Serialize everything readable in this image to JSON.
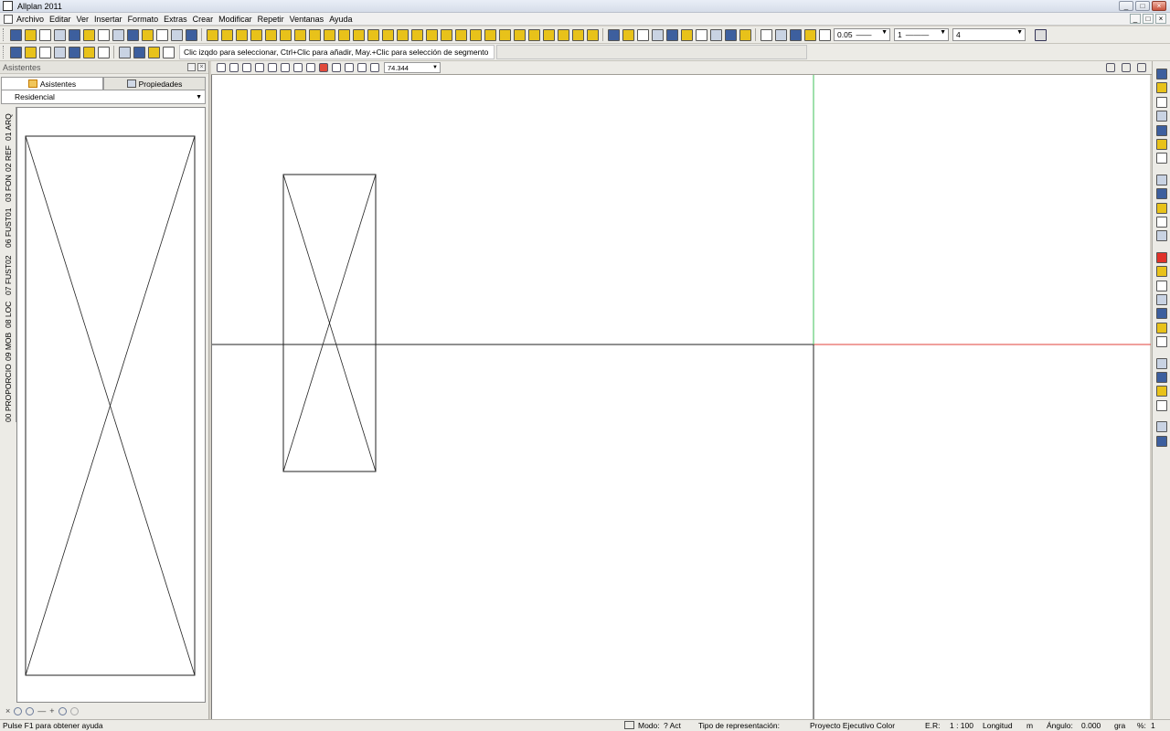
{
  "window": {
    "title": "Allplan 2011",
    "minimize": "_",
    "maximize": "□",
    "close": "×"
  },
  "menu": {
    "items": [
      "Archivo",
      "Editar",
      "Ver",
      "Insertar",
      "Formato",
      "Extras",
      "Crear",
      "Modificar",
      "Repetir",
      "Ventanas",
      "Ayuda"
    ]
  },
  "toolbar": {
    "pen_thickness": "0.05",
    "line_type": "1",
    "line_color": "4",
    "hint": "Clic izqdo para seleccionar, Ctrl+Clic para añadir, May.+Clic para selección de segmento"
  },
  "panel": {
    "title": "Asistentes",
    "tabs": [
      {
        "label": "Asistentes"
      },
      {
        "label": "Propiedades"
      }
    ],
    "selected_assistant": "Residencial",
    "vertical_tabs": [
      "01 ARQ",
      "02 REF",
      "03 FON",
      "06 FUST01",
      "07 FUST02",
      "08 LOC",
      "09 MOB",
      "00 PROPORCIO"
    ],
    "close_label": "×"
  },
  "view": {
    "zoom": "74.344"
  },
  "status": {
    "help": "Pulse F1 para obtener ayuda",
    "mode_label": "Modo:",
    "mode_value": "? Act",
    "repr_label": "Tipo de representación:",
    "repr_value": "Proyecto Ejecutivo Color",
    "scale_label": "E.R:",
    "scale_value": "1 : 100",
    "length_label": "Longitud",
    "length_unit": "m",
    "angle_label": "Ángulo:",
    "angle_value": "0.000",
    "angle_unit": "gra",
    "percent_label": "%:",
    "percent_value": "1"
  },
  "colors": {
    "axis_x": "#e0403a",
    "axis_y": "#3fc25a",
    "toolbar_icon_yellow": "#e8c21a",
    "toolbar_icon_blue": "#3d5f9e"
  },
  "icons": {
    "toolbar1": [
      "new-icon",
      "open-icon",
      "save-icon",
      "print-icon",
      "preview-icon",
      "layout-icon",
      "image-icon",
      "export-icon",
      "import-icon",
      "measure-icon",
      "paint-icon",
      "undo-icon",
      "redo-icon",
      "wall-icon",
      "wall2-icon",
      "wall3-icon",
      "beam-icon",
      "column-icon",
      "line-icon",
      "slab-icon",
      "roof-icon",
      "stair-icon",
      "window-icon",
      "door-icon",
      "opening-icon",
      "niche-icon",
      "skylight-icon",
      "room-icon",
      "facade-icon",
      "hatch-icon",
      "pattern-icon",
      "text-icon",
      "dimension-icon",
      "grid-icon",
      "table-icon",
      "list-icon",
      "report-icon",
      "label-icon",
      "layer-icon",
      "pen-icon",
      "stroke-icon",
      "color-icon",
      "filter-icon",
      "find-icon",
      "binocular-icon",
      "hatch2-icon",
      "stripes-icon",
      "arc-icon",
      "mirror-icon",
      "copy-icon",
      "pipette-icon",
      "pen-weight-icon",
      "line-type-icon",
      "line-color-icon",
      "fill-icon"
    ],
    "toolbar2": [
      "pipette-icon",
      "layer-icon",
      "pencil-icon",
      "eraser-icon",
      "color-icon",
      "filter-icon",
      "select-icon",
      "properties-icon",
      "paint-icon",
      "copy-icon",
      "paste-icon"
    ],
    "view_toolbar": [
      "zoom-all-icon",
      "zoom-window-icon",
      "pan-icon",
      "regen-icon",
      "zoom-out-icon",
      "zoom-in-icon",
      "prev-view-icon",
      "navigation-icon",
      "render-icon",
      "rotate-icon",
      "undo-view-icon",
      "redo-view-icon",
      "play-icon"
    ],
    "right_toolbar": [
      "building-icon",
      "dimension-icon",
      "text-icon",
      "measure-icon",
      "palette-icon",
      "image-icon",
      "grid-icon",
      "sphere-icon",
      "plan-icon",
      "layers-icon",
      "table-icon",
      "animation-icon",
      "red-square-icon",
      "wall-icon",
      "roof-icon",
      "stair-icon",
      "railing-icon",
      "hatch-icon",
      "beam-icon",
      "search-icon",
      "camera-icon",
      "binocular-icon",
      "render-icon",
      "chart-icon",
      "window-icon"
    ]
  }
}
